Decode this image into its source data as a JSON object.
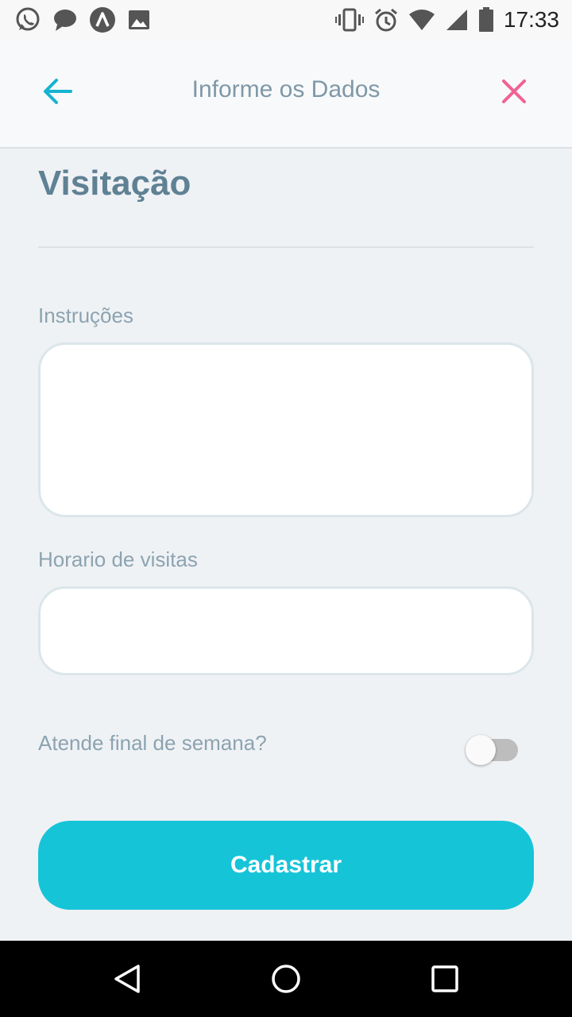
{
  "status_bar": {
    "time": "17:33",
    "icons_left": [
      "whatsapp-icon",
      "chat-icon",
      "app-icon",
      "image-icon"
    ],
    "icons_right": [
      "vibrate-icon",
      "alarm-icon",
      "wifi-icon",
      "signal-icon",
      "battery-icon"
    ]
  },
  "header": {
    "title": "Informe os Dados",
    "back_icon": "arrow-left-icon",
    "close_icon": "close-icon",
    "accent_color": "#16b3d1",
    "close_color": "#f06292"
  },
  "page": {
    "title": "Visitação"
  },
  "form": {
    "instructions_label": "Instruções",
    "instructions_value": "",
    "visit_hours_label": "Horario de visitas",
    "visit_hours_value": "",
    "weekend_label": "Atende final de semana?",
    "weekend_enabled": false,
    "submit_label": "Cadastrar",
    "submit_color": "#16c4d8"
  },
  "nav_bar": {
    "icons": [
      "nav-back-icon",
      "nav-home-icon",
      "nav-recents-icon"
    ]
  }
}
